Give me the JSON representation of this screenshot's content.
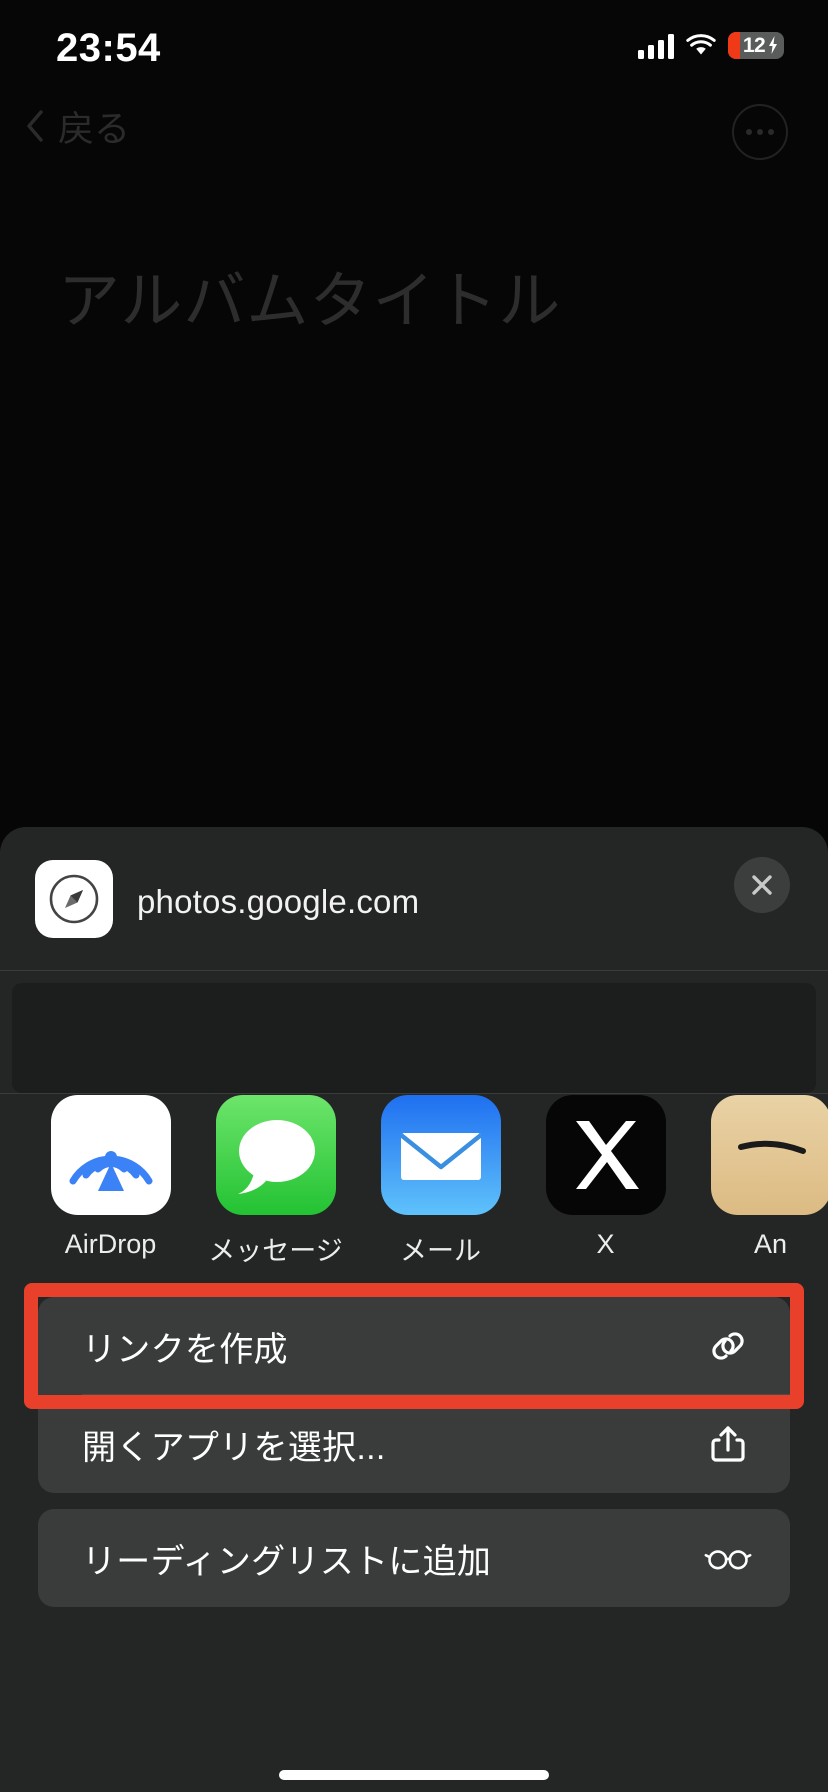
{
  "status_bar": {
    "time": "23:54",
    "battery_level": "12",
    "battery_color": "#F03A17",
    "charging": true,
    "signal_icon": "cellular-signal-icon",
    "wifi_icon": "wifi-icon",
    "battery_icon": "battery-icon"
  },
  "nav": {
    "back_label": "戻る",
    "back_icon": "chevron-left-icon",
    "more_icon": "ellipsis-circle-icon"
  },
  "page": {
    "album_title_placeholder": "アルバムタイトル"
  },
  "share_sheet": {
    "source_url": "photos.google.com",
    "source_app_icon": "safari-compass-icon",
    "close_icon": "close-icon",
    "apps": [
      {
        "label": "AirDrop",
        "icon": "airdrop-icon"
      },
      {
        "label": "メッセージ",
        "icon": "messages-icon"
      },
      {
        "label": "メール",
        "icon": "mail-icon"
      },
      {
        "label": "X",
        "icon": "x-app-icon"
      },
      {
        "label": "An",
        "icon": "an-app-icon"
      }
    ],
    "actions": [
      {
        "label": "リンクを作成",
        "icon": "link-icon",
        "highlighted": true
      },
      {
        "label": "開くアプリを選択...",
        "icon": "share-icon",
        "highlighted": false
      },
      {
        "label": "リーディングリストに追加",
        "icon": "glasses-icon",
        "highlighted": false
      }
    ],
    "highlight_color": "#E8402A"
  }
}
